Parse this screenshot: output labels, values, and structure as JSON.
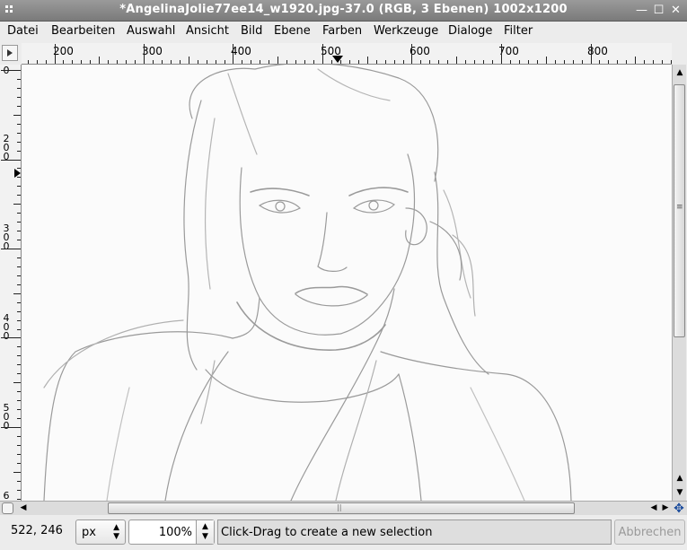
{
  "window": {
    "title": "*AngelinaJolie77ee14_w1920.jpg-37.0 (RGB, 3 Ebenen) 1002x1200",
    "minimize_glyph": "—",
    "maximize_glyph": "☐",
    "close_glyph": "✕"
  },
  "menu": [
    {
      "label": "Datei"
    },
    {
      "label": "Bearbeiten"
    },
    {
      "label": "Auswahl"
    },
    {
      "label": "Ansicht"
    },
    {
      "label": "Bild"
    },
    {
      "label": "Ebene"
    },
    {
      "label": "Farben"
    },
    {
      "label": "Werkzeuge"
    },
    {
      "label": "Dialoge"
    },
    {
      "label": "Filter"
    }
  ],
  "rulers": {
    "horizontal_labels": [
      "200",
      "300",
      "400",
      "500",
      "600",
      "700",
      "800"
    ],
    "vertical_labels": [
      "0",
      "200",
      "300",
      "400",
      "500",
      "6"
    ]
  },
  "statusbar": {
    "coordinates": "522, 246",
    "unit": "px",
    "zoom": "100%",
    "message": "Click-Drag to create a new selection",
    "cancel_label": "Abbrechen"
  },
  "icons": {
    "menu_grip": "menu-grip-icon",
    "ruler_corner": "quick-mask-icon",
    "navigate": "navigate-icon",
    "move": "move-arrows-icon"
  },
  "colors": {
    "titlebar": "#8a8a8a",
    "canvas": "#fbfbfb",
    "sketch_lines": "#9a9a9a"
  }
}
